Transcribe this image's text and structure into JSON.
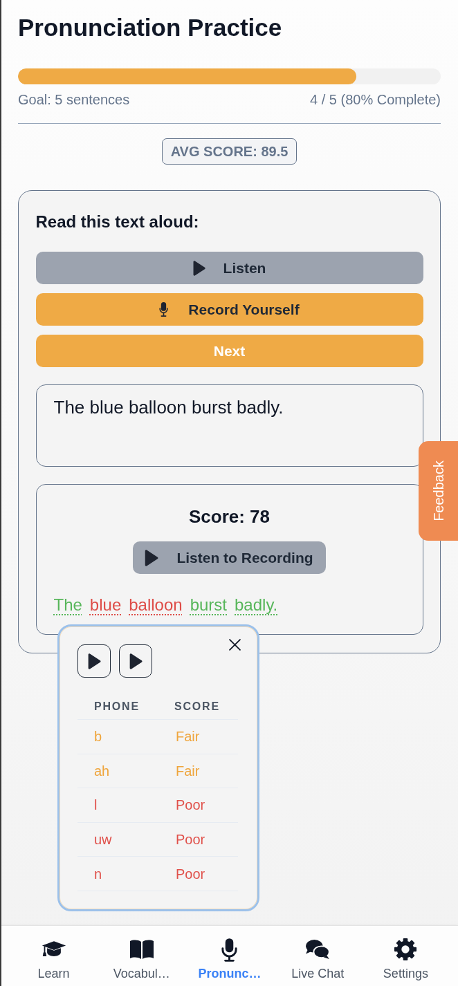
{
  "title": "Pronunciation Practice",
  "progress": {
    "level": 0.8,
    "goal": "Goal: 5 sentences",
    "status": "4 / 5 (80% Complete)"
  },
  "avg_score_badge": "AVG SCORE: 89.5",
  "practice_card": {
    "heading": "Read this text aloud:",
    "buttons": [
      {
        "kind": "listen",
        "label": "Listen"
      },
      {
        "kind": "record",
        "label": "Record Yourself"
      },
      {
        "kind": "next",
        "label": "Next"
      }
    ],
    "sentence": "The blue balloon burst badly.",
    "result": {
      "score": "Score: 78",
      "playback_button": "Listen to Recording",
      "words": [
        {
          "text": "The",
          "color": "#57b65a"
        },
        {
          "text": "blue",
          "color": "#de4d48"
        },
        {
          "text": "balloon",
          "color": "#de4d48"
        },
        {
          "text": "burst",
          "color": "#57b65a"
        },
        {
          "text": "badly.",
          "color": "#57b65a"
        }
      ]
    }
  },
  "phone_popup": {
    "columns": [
      "PHONE",
      "SCORE"
    ],
    "rows": [
      {
        "phone": "b",
        "score": "Fair",
        "color": "#efa53c"
      },
      {
        "phone": "ah",
        "score": "Fair",
        "color": "#efa53c"
      },
      {
        "phone": "l",
        "score": "Poor",
        "color": "#e0504a"
      },
      {
        "phone": "uw",
        "score": "Poor",
        "color": "#e0504a"
      },
      {
        "phone": "n",
        "score": "Poor",
        "color": "#e0504a"
      }
    ]
  },
  "feedback_tab": "Feedback",
  "bottom_nav": [
    {
      "label": "Learn",
      "selected": false
    },
    {
      "label": "Vocabul…",
      "selected": false
    },
    {
      "label": "Pronunc…",
      "selected": true
    },
    {
      "label": "Live Chat",
      "selected": false
    },
    {
      "label": "Settings",
      "selected": false
    }
  ]
}
